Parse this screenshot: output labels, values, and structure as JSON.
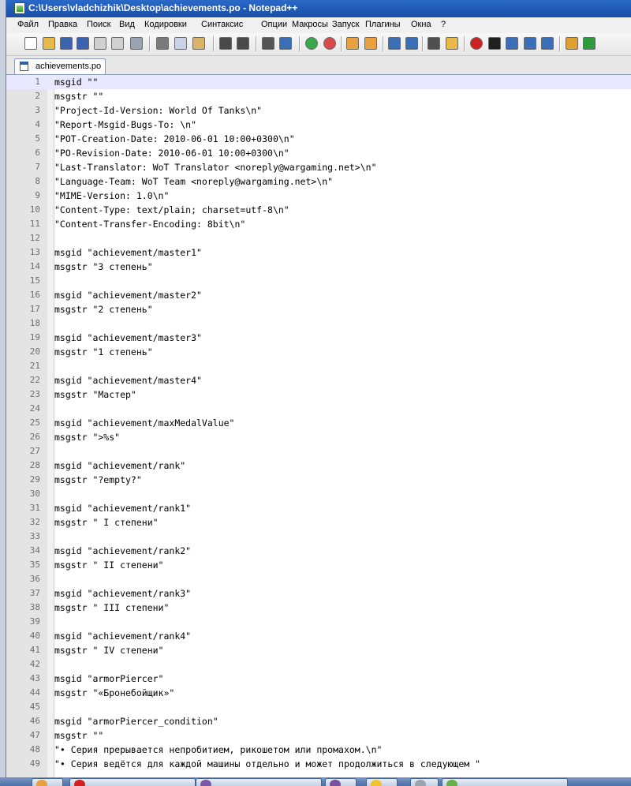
{
  "window": {
    "title": "C:\\Users\\vladchizhik\\Desktop\\achievements.po - Notepad++"
  },
  "menu": [
    "Файл",
    "Правка",
    "Поиск",
    "Вид",
    "Кодировки",
    "Синтаксис",
    "Опции",
    "Макросы",
    "Запуск",
    "Плагины",
    "Окна",
    "?"
  ],
  "toolbar": {
    "buttons": [
      {
        "icon": "new-file-icon",
        "color": "#ffffff"
      },
      {
        "icon": "open-file-icon",
        "color": "#e8b84a"
      },
      {
        "icon": "save-icon",
        "color": "#3a64b0"
      },
      {
        "icon": "save-all-icon",
        "color": "#3a64b0"
      },
      {
        "icon": "close-icon",
        "color": "#d0d0d0"
      },
      {
        "icon": "close-all-icon",
        "color": "#d0d0d0"
      },
      {
        "icon": "print-icon",
        "color": "#9aa4b0"
      },
      {
        "icon": "cut-icon",
        "color": "#7a7a7a"
      },
      {
        "icon": "copy-icon",
        "color": "#c8d4e6"
      },
      {
        "icon": "paste-icon",
        "color": "#d9b46a"
      },
      {
        "icon": "undo-icon",
        "color": "#4a4a4a"
      },
      {
        "icon": "redo-icon",
        "color": "#4a4a4a"
      },
      {
        "icon": "find-icon",
        "color": "#555555"
      },
      {
        "icon": "replace-icon",
        "color": "#3a6fb8"
      },
      {
        "icon": "zoom-in-icon",
        "color": "#3aa84a"
      },
      {
        "icon": "zoom-out-icon",
        "color": "#d84a4a"
      },
      {
        "icon": "sync-vertical-icon",
        "color": "#e8a040"
      },
      {
        "icon": "sync-horizontal-icon",
        "color": "#e8a040"
      },
      {
        "icon": "word-wrap-icon",
        "color": "#3a6fb8"
      },
      {
        "icon": "show-all-chars-icon",
        "color": "#3a6fb8"
      },
      {
        "icon": "indent-guide-icon",
        "color": "#505050"
      },
      {
        "icon": "folder-as-workspace-icon",
        "color": "#e8b84a"
      },
      {
        "icon": "record-macro-icon",
        "color": "#d02020"
      },
      {
        "icon": "stop-record-icon",
        "color": "#202020"
      },
      {
        "icon": "play-macro-icon",
        "color": "#3a6fb8"
      },
      {
        "icon": "run-macro-multiple-icon",
        "color": "#3a6fb8"
      },
      {
        "icon": "save-macro-icon",
        "color": "#3a6fb8"
      },
      {
        "icon": "plugin-icon",
        "color": "#e0a030"
      },
      {
        "icon": "spell-check-icon",
        "color": "#2c9c3a"
      }
    ]
  },
  "tab": {
    "label": "achievements.po"
  },
  "editor": {
    "current_line": 1,
    "lines": [
      {
        "n": "1",
        "text": "msgid \"\""
      },
      {
        "n": "2",
        "text": "msgstr \"\""
      },
      {
        "n": "3",
        "text": "\"Project-Id-Version: World Of Tanks\\n\""
      },
      {
        "n": "4",
        "text": "\"Report-Msgid-Bugs-To: \\n\""
      },
      {
        "n": "5",
        "text": "\"POT-Creation-Date: 2010-06-01 10:00+0300\\n\""
      },
      {
        "n": "6",
        "text": "\"PO-Revision-Date: 2010-06-01 10:00+0300\\n\""
      },
      {
        "n": "7",
        "text": "\"Last-Translator: WoT Translator <noreply@wargaming.net>\\n\""
      },
      {
        "n": "8",
        "text": "\"Language-Team: WoT Team <noreply@wargaming.net>\\n\""
      },
      {
        "n": "9",
        "text": "\"MIME-Version: 1.0\\n\""
      },
      {
        "n": "10",
        "text": "\"Content-Type: text/plain; charset=utf-8\\n\""
      },
      {
        "n": "11",
        "text": "\"Content-Transfer-Encoding: 8bit\\n\""
      },
      {
        "n": "12",
        "text": ""
      },
      {
        "n": "13",
        "text": "msgid \"achievement/master1\""
      },
      {
        "n": "14",
        "text": "msgstr \"3 степень\""
      },
      {
        "n": "15",
        "text": ""
      },
      {
        "n": "16",
        "text": "msgid \"achievement/master2\""
      },
      {
        "n": "17",
        "text": "msgstr \"2 степень\""
      },
      {
        "n": "18",
        "text": ""
      },
      {
        "n": "19",
        "text": "msgid \"achievement/master3\""
      },
      {
        "n": "20",
        "text": "msgstr \"1 степень\""
      },
      {
        "n": "21",
        "text": ""
      },
      {
        "n": "22",
        "text": "msgid \"achievement/master4\""
      },
      {
        "n": "23",
        "text": "msgstr \"Мастер\""
      },
      {
        "n": "24",
        "text": ""
      },
      {
        "n": "25",
        "text": "msgid \"achievement/maxMedalValue\""
      },
      {
        "n": "26",
        "text": "msgstr \">%s\""
      },
      {
        "n": "27",
        "text": ""
      },
      {
        "n": "28",
        "text": "msgid \"achievement/rank\""
      },
      {
        "n": "29",
        "text": "msgstr \"?empty?\""
      },
      {
        "n": "30",
        "text": ""
      },
      {
        "n": "31",
        "text": "msgid \"achievement/rank1\""
      },
      {
        "n": "32",
        "text": "msgstr \" I степени\""
      },
      {
        "n": "33",
        "text": ""
      },
      {
        "n": "34",
        "text": "msgid \"achievement/rank2\""
      },
      {
        "n": "35",
        "text": "msgstr \" II степени\""
      },
      {
        "n": "36",
        "text": ""
      },
      {
        "n": "37",
        "text": "msgid \"achievement/rank3\""
      },
      {
        "n": "38",
        "text": "msgstr \" III степени\""
      },
      {
        "n": "39",
        "text": ""
      },
      {
        "n": "40",
        "text": "msgid \"achievement/rank4\""
      },
      {
        "n": "41",
        "text": "msgstr \" IV степени\""
      },
      {
        "n": "42",
        "text": ""
      },
      {
        "n": "43",
        "text": "msgid \"armorPiercer\""
      },
      {
        "n": "44",
        "text": "msgstr \"«Бронебойщик»\""
      },
      {
        "n": "45",
        "text": ""
      },
      {
        "n": "46",
        "text": "msgid \"armorPiercer_condition\""
      },
      {
        "n": "47",
        "text": "msgstr \"\""
      },
      {
        "n": "48",
        "text": "\"• Серия прерывается непробитием, рикошетом или промахом.\\n\""
      },
      {
        "n": "49",
        "text": "\"• Серия ведётся для каждой машины отдельно и может продолжиться в следующем \""
      }
    ]
  },
  "taskbar": {
    "items": [
      {
        "icon": "explorer-icon",
        "color": "#e8a040",
        "label": ""
      },
      {
        "icon": "opera-icon",
        "color": "#d02020",
        "label": ""
      },
      {
        "icon": "app-window-icon",
        "color": "#7a5aa8",
        "label": ""
      },
      {
        "icon": "viber-icon",
        "color": "#7b519d",
        "label": ""
      },
      {
        "icon": "google-drive-icon",
        "color": "#f2c230",
        "label": ""
      },
      {
        "icon": "chrome-icon",
        "color": "#9aa4b0",
        "label": ""
      },
      {
        "icon": "notepadpp-icon",
        "color": "#6ab04a",
        "label": ""
      }
    ]
  }
}
